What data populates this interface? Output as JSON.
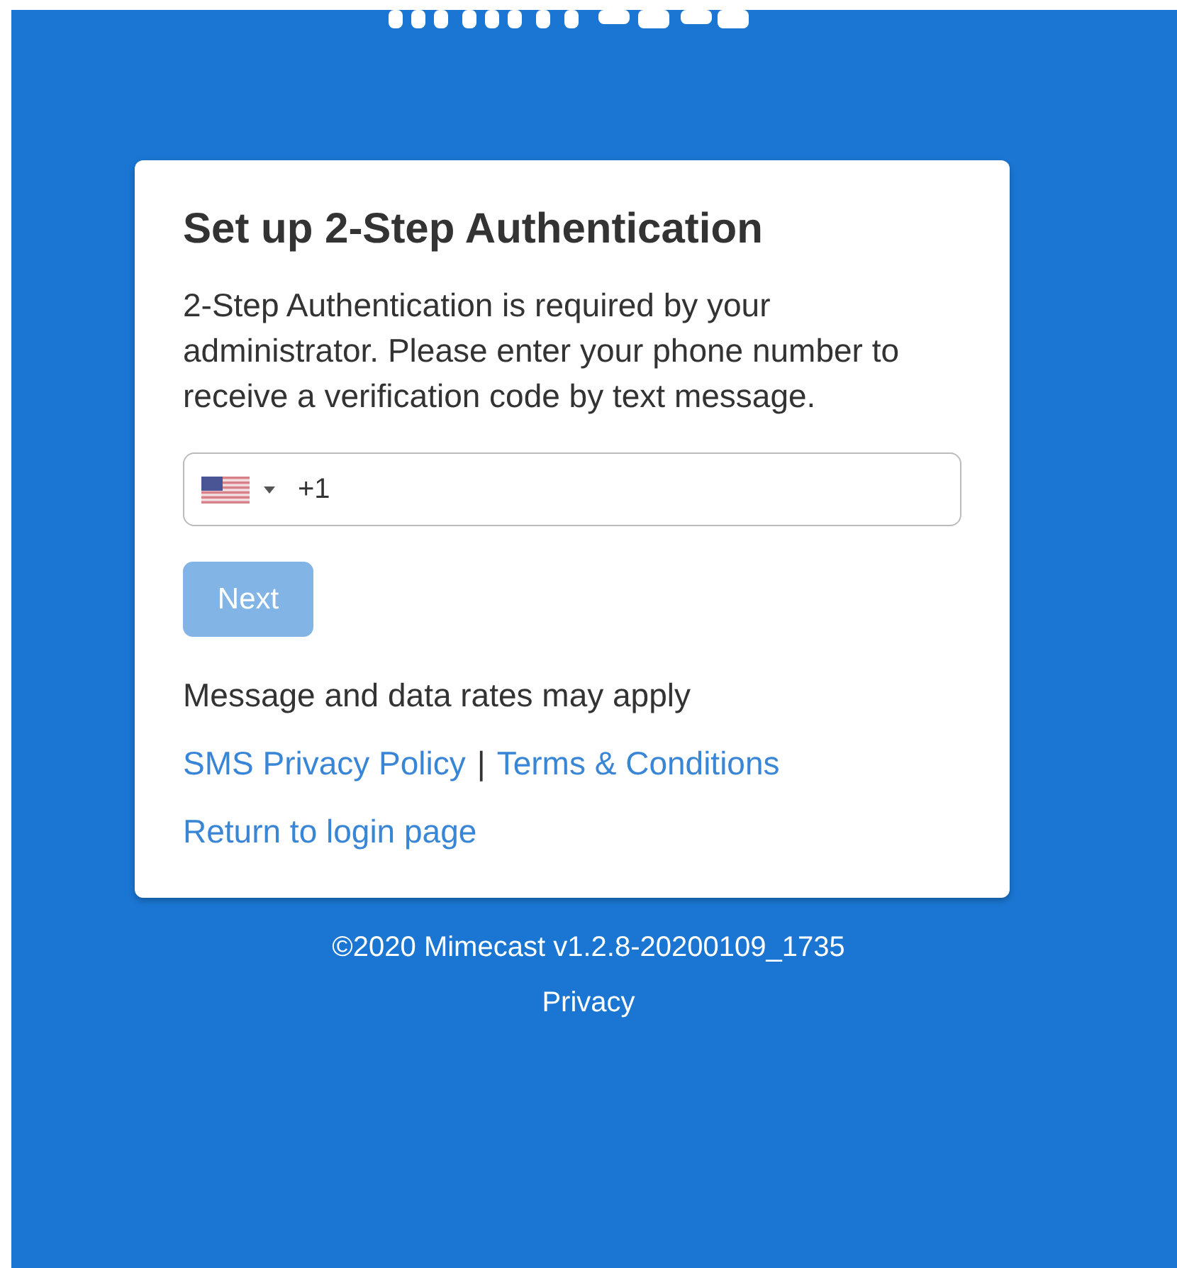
{
  "card": {
    "title": "Set up 2-Step Authentication",
    "description": "2-Step Authentication is required by your administrator. Please enter your phone number to receive a verification code by text message.",
    "phone_field": {
      "value": "+1"
    },
    "next_button": {
      "label": "Next",
      "disabled": true
    },
    "notice": "Message and data rates may apply",
    "links": [
      {
        "label": "SMS Privacy Policy"
      },
      {
        "label": "Terms & Conditions"
      }
    ],
    "separator": "|",
    "return_link": "Return to login page"
  },
  "footer": {
    "copyright": "©2020 Mimecast v1.2.8-20200109_1735",
    "privacy_link": "Privacy"
  }
}
